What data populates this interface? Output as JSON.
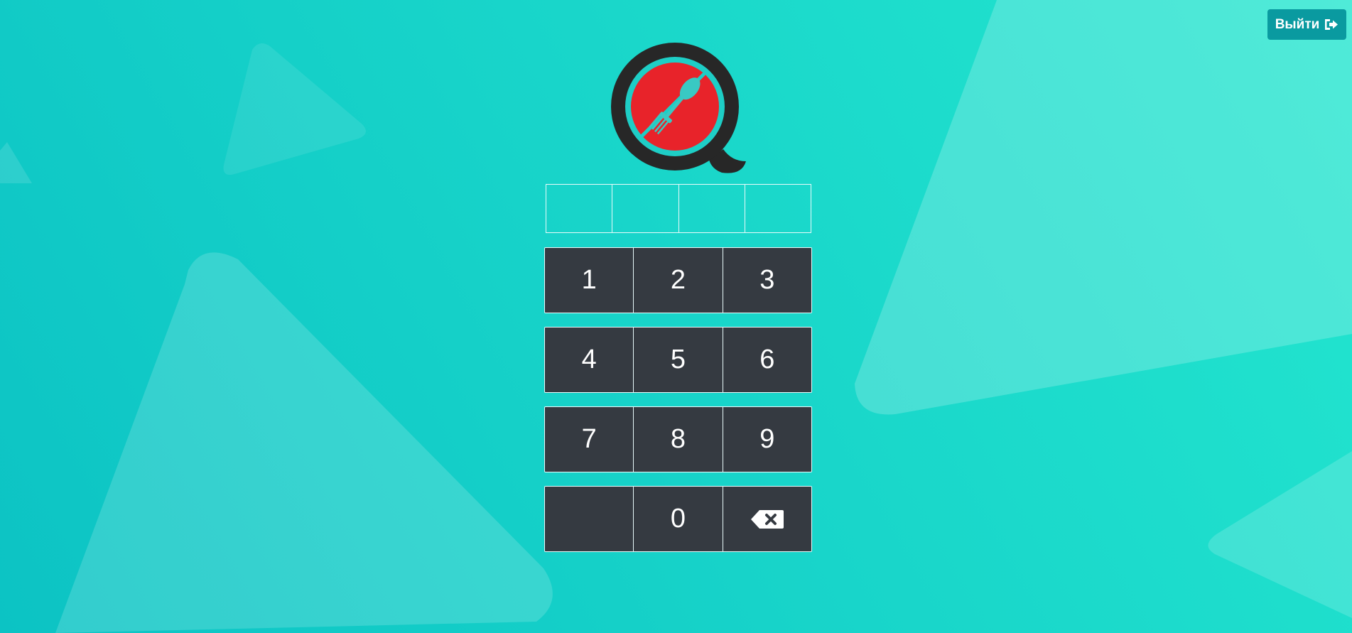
{
  "header": {
    "logout_label": "Выйти",
    "logout_icon": "sign-out-icon"
  },
  "logo": {
    "icon": "spoon-fork-q-logo",
    "colors": {
      "ring": "#272727",
      "inner_ring": "#1ecec6",
      "plate": "#e8232a",
      "utensils": "#39c9c3"
    }
  },
  "pin": {
    "cells": [
      "",
      "",
      "",
      ""
    ]
  },
  "keypad": {
    "rows": [
      [
        "1",
        "2",
        "3"
      ],
      [
        "4",
        "5",
        "6"
      ],
      [
        "7",
        "8",
        "9"
      ],
      [
        "",
        "0",
        ""
      ]
    ],
    "backspace_icon": "backspace-icon"
  },
  "colors": {
    "background_start": "#0cc3c4",
    "background_end": "#23e6cf",
    "key_background": "#353a41",
    "key_text": "#ffffff",
    "logout_background": "#0a9aa0"
  }
}
